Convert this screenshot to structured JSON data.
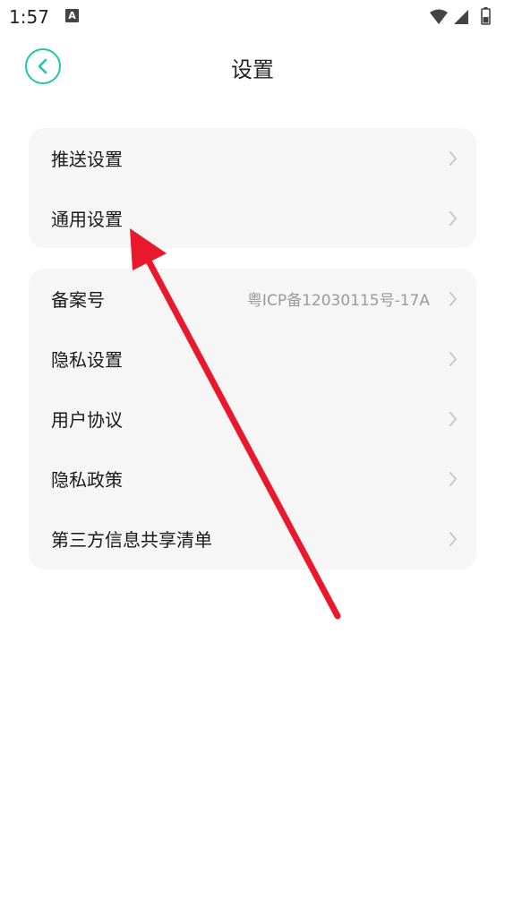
{
  "status_bar": {
    "time": "1:57",
    "notification_icon": "A"
  },
  "header": {
    "title": "设置",
    "back_icon": "chevron-left-icon"
  },
  "card1": {
    "items": [
      {
        "label": "推送设置"
      },
      {
        "label": "通用设置"
      }
    ]
  },
  "card2": {
    "items": [
      {
        "label": "备案号",
        "value": "粤ICP备12030115号-17A"
      },
      {
        "label": "隐私设置"
      },
      {
        "label": "用户协议"
      },
      {
        "label": "隐私政策"
      },
      {
        "label": "第三方信息共享清单"
      }
    ]
  },
  "colors": {
    "accent": "#1fc6b0",
    "card_bg": "#f6f6f6",
    "annotation": "#e8192c"
  }
}
